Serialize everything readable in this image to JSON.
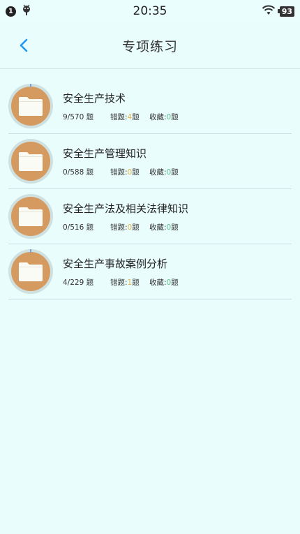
{
  "status_bar": {
    "notification_count": "1",
    "time": "20:35",
    "battery": "93"
  },
  "header": {
    "title": "专项练习"
  },
  "labels": {
    "unit": "题",
    "wrong_label": "错题:",
    "fav_label": "收藏:"
  },
  "items": [
    {
      "title": "安全生产技术",
      "progress": "9/570",
      "wrong": "4",
      "favorites": "0"
    },
    {
      "title": "安全生产管理知识",
      "progress": "0/588",
      "wrong": "0",
      "favorites": "0"
    },
    {
      "title": "安全生产法及相关法律知识",
      "progress": "0/516",
      "wrong": "0",
      "favorites": "0"
    },
    {
      "title": "安全生产事故案例分析",
      "progress": "4/229",
      "wrong": "1",
      "favorites": "0"
    }
  ],
  "colors": {
    "background": "#e9fdfd",
    "folder_circle": "#d49a5f",
    "wrong_highlight": "#e3b44a",
    "fav_highlight": "#5cc08a",
    "back_arrow": "#2196f3"
  }
}
